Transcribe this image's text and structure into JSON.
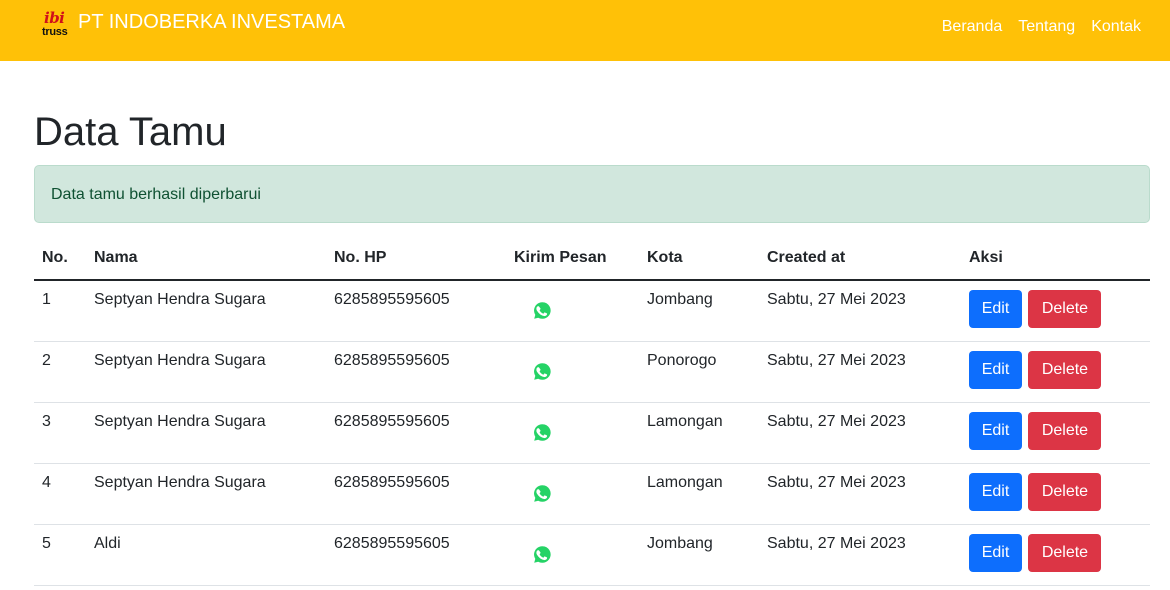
{
  "navbar": {
    "logo_text_top": "ibi",
    "logo_text_bottom": "truss",
    "brand": "PT INDOBERKA INVESTAMA",
    "links": [
      "Beranda",
      "Tentang",
      "Kontak"
    ]
  },
  "page": {
    "title": "Data Tamu",
    "alert": "Data tamu berhasil diperbarui"
  },
  "table": {
    "headers": [
      "No.",
      "Nama",
      "No. HP",
      "Kirim Pesan",
      "Kota",
      "Created at",
      "Aksi"
    ],
    "rows": [
      {
        "no": "1",
        "nama": "Septyan Hendra Sugara",
        "hp": "6285895595605",
        "kota": "Jombang",
        "created": "Sabtu, 27 Mei 2023"
      },
      {
        "no": "2",
        "nama": "Septyan Hendra Sugara",
        "hp": "6285895595605",
        "kota": "Ponorogo",
        "created": "Sabtu, 27 Mei 2023"
      },
      {
        "no": "3",
        "nama": "Septyan Hendra Sugara",
        "hp": "6285895595605",
        "kota": "Lamongan",
        "created": "Sabtu, 27 Mei 2023"
      },
      {
        "no": "4",
        "nama": "Septyan Hendra Sugara",
        "hp": "6285895595605",
        "kota": "Lamongan",
        "created": "Sabtu, 27 Mei 2023"
      },
      {
        "no": "5",
        "nama": "Aldi",
        "hp": "6285895595605",
        "kota": "Jombang",
        "created": "Sabtu, 27 Mei 2023"
      }
    ],
    "edit_label": "Edit",
    "delete_label": "Delete",
    "message_icon": "whatsapp-icon"
  },
  "colors": {
    "navbar": "#ffc107",
    "edit": "#0d6efd",
    "delete": "#dc3545",
    "alert_bg": "#d1e7dd",
    "whatsapp": "#25d366"
  }
}
